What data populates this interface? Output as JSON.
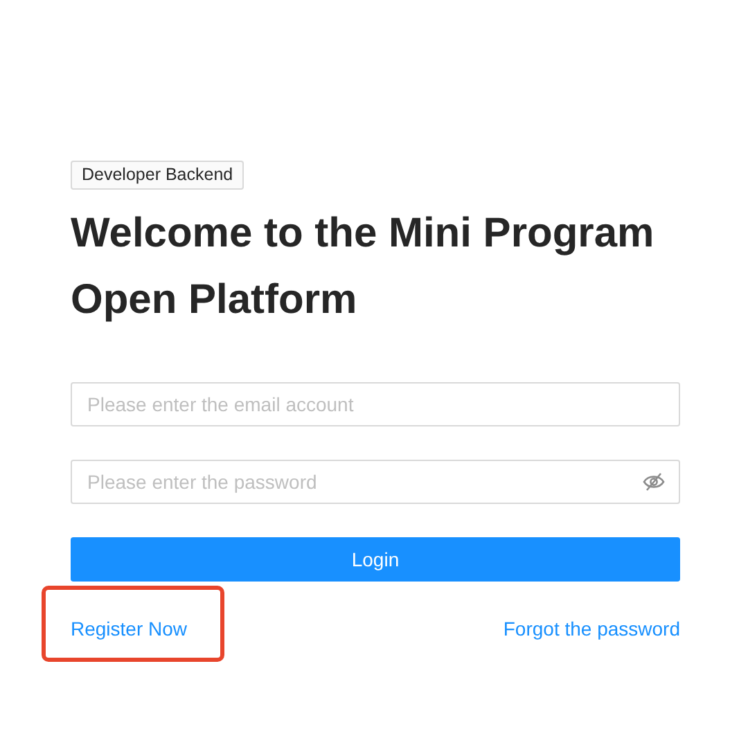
{
  "tag": "Developer Backend",
  "title_lines": [
    "Welcome to the Mini Program",
    "Open Platform"
  ],
  "fields": [
    {
      "kind": "email",
      "placeholder": "Please enter the email account"
    },
    {
      "kind": "password",
      "placeholder": "Please enter the password"
    }
  ],
  "login_button": "Login",
  "links": [
    {
      "label": "Register Now",
      "highlighted": true
    },
    {
      "label": "Forgot the password",
      "highlighted": false
    }
  ]
}
